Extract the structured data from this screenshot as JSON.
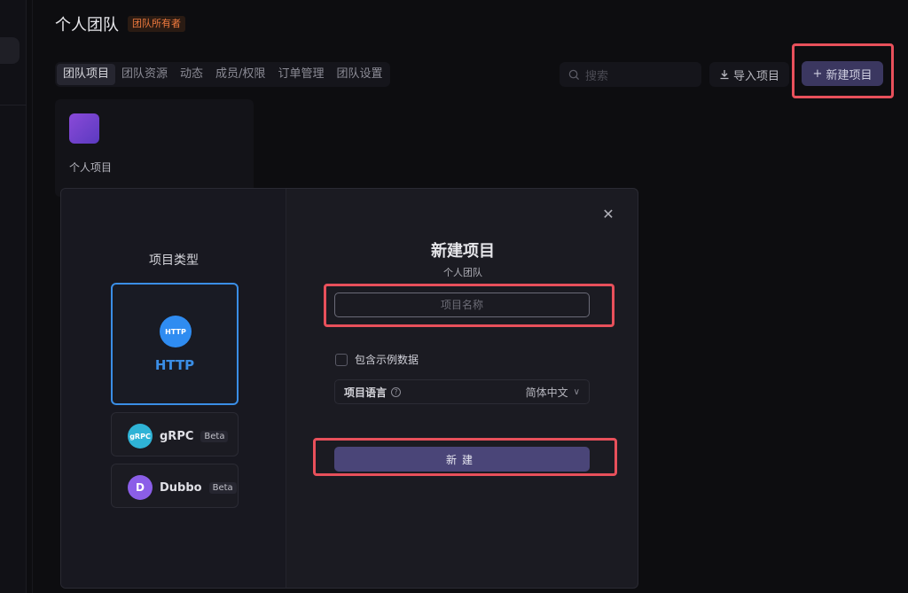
{
  "header": {
    "team_title": "个人团队",
    "owner_badge": "团队所有者"
  },
  "tabs": [
    {
      "label": "团队项目",
      "active": true
    },
    {
      "label": "团队资源"
    },
    {
      "label": "动态"
    },
    {
      "label": "成员/权限"
    },
    {
      "label": "订单管理"
    },
    {
      "label": "团队设置"
    }
  ],
  "toolbar": {
    "search_placeholder": "搜索",
    "import_label": "导入项目",
    "new_label": "新建项目",
    "icons": {
      "search": "search-icon",
      "import": "import-icon",
      "plus": "plus-icon"
    }
  },
  "projects": [
    {
      "name": "个人项目"
    }
  ],
  "modal": {
    "type_heading": "项目类型",
    "types": [
      {
        "name": "HTTP",
        "icon_text": "HTTP",
        "selected": true
      },
      {
        "name": "gRPC",
        "icon_text": "gRPC",
        "badge": "Beta"
      },
      {
        "name": "Dubbo",
        "icon_text": "D",
        "badge": "Beta"
      }
    ],
    "title": "新建项目",
    "subtitle": "个人团队",
    "name_placeholder": "项目名称",
    "include_sample_label": "包含示例数据",
    "language_label": "项目语言",
    "language_value": "简体中文",
    "create_label": "新建"
  },
  "colors": {
    "accent": "#3a8ee6",
    "primary_button": "#4a4578",
    "highlight": "#e8505b"
  }
}
